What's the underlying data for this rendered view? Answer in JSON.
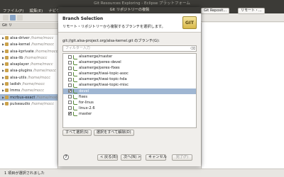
{
  "top_bar": {
    "title": "Git Resources Exploring - Eclipse プラットフォーム"
  },
  "menubar": [
    "ファイル(F)",
    "編集(E)",
    "ナビゲー"
  ],
  "perspectives": {
    "git_repositories": "Git Reposit...",
    "remote": "リモート・..."
  },
  "left_view": {
    "tab_label": "Git リ",
    "repos": [
      {
        "name": "alsa-driver",
        "path": "/home/mocc"
      },
      {
        "name": "alsa-kernel",
        "path": "/home/mocc"
      },
      {
        "name": "alsa-kprivate",
        "path": "/home/mocc"
      },
      {
        "name": "alsa-lib",
        "path": "/home/mocc"
      },
      {
        "name": "alsaplayer",
        "path": "/home/mocc"
      },
      {
        "name": "alsa-plugins",
        "path": "/home/mocc"
      },
      {
        "name": "alsa-utils",
        "path": "/home/mocc"
      },
      {
        "name": "ladish",
        "path": "/home/mocc"
      },
      {
        "name": "lmms",
        "path": "/home/mocc"
      },
      {
        "name": "mcrbus-exact",
        "path": "/home/mocc",
        "selected": true
      },
      {
        "name": "pulseaudio",
        "path": "/home/mocc"
      }
    ]
  },
  "status_bar": {
    "text": "1 項目が選択されました"
  },
  "dialog": {
    "window_title": "Git リポジトリーの複製",
    "header_title": "Branch Selection",
    "header_desc": "リモート・リポジトリーから複製するブランチを選択します。",
    "logo_text": "GIT",
    "branch_label": "git://git.alsa-project.org/alsa-kernel.git のブランチ(G):",
    "filter_placeholder": "フィルター入力",
    "branches": [
      {
        "name": "alsamerge/master",
        "checked": false,
        "selected": false
      },
      {
        "name": "alsamerge/perex-devel",
        "checked": false,
        "selected": false
      },
      {
        "name": "alsamerge/perex-fixes",
        "checked": false,
        "selected": false
      },
      {
        "name": "alsamerge/tiwai-topic-asoc",
        "checked": false,
        "selected": false
      },
      {
        "name": "alsamerge/tiwai-topic-hda",
        "checked": false,
        "selected": false
      },
      {
        "name": "alsamerge/tiwai-topic-misc",
        "checked": false,
        "selected": false
      },
      {
        "name": "devel",
        "checked": true,
        "selected": true
      },
      {
        "name": "fixes",
        "checked": false,
        "selected": false
      },
      {
        "name": "for-linus",
        "checked": false,
        "selected": false
      },
      {
        "name": "linux-2.6",
        "checked": false,
        "selected": false
      },
      {
        "name": "master",
        "checked": true,
        "selected": false
      }
    ],
    "select_all": "すべて選択(S)",
    "deselect_all": "選択をすべて解除(D)",
    "footer": {
      "help": "?",
      "back": "< 戻る(B)",
      "next": "次へ(N) >",
      "cancel": "キャンセル",
      "finish": "完了(F)"
    }
  },
  "colors": {
    "selection": "#9fb6d2",
    "titlebar": "#3c3b37",
    "branch_icon": "#5a8a3a"
  }
}
